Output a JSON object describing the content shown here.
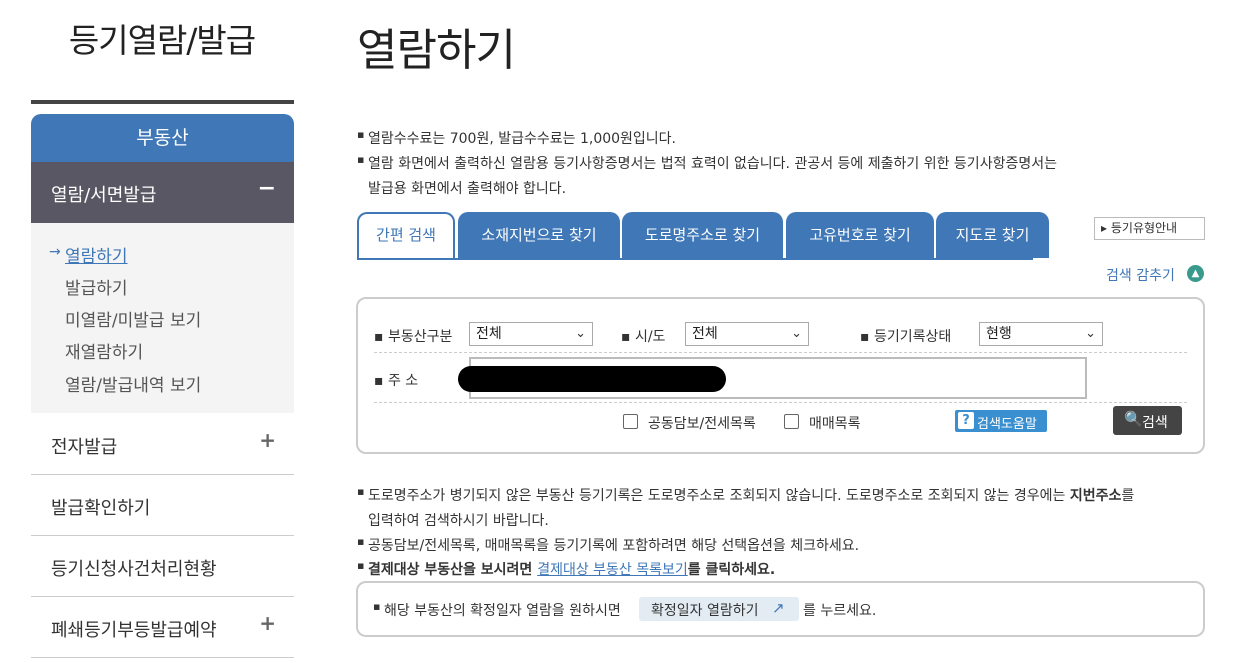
{
  "sidebar": {
    "title": "등기열람/발급",
    "category": "부동산",
    "active_section": {
      "label": "열람/서면발급",
      "toggle": "−"
    },
    "sub_items": [
      {
        "label": "열람하기"
      },
      {
        "label": "발급하기"
      },
      {
        "label": "미열람/미발급 보기"
      },
      {
        "label": "재열람하기"
      },
      {
        "label": "열람/발급내역 보기"
      }
    ],
    "sub_arrow": "→",
    "menus": [
      {
        "label": "전자발급",
        "toggle": "+"
      },
      {
        "label": "발급확인하기",
        "toggle": ""
      },
      {
        "label": "등기신청사건처리현황",
        "toggle": ""
      },
      {
        "label": "폐쇄등기부등발급예약",
        "toggle": "+"
      }
    ]
  },
  "main": {
    "title": "열람하기",
    "notices": [
      "열람수수료는 700원, 발급수수료는 1,000원입니다.",
      "열람 화면에서 출력하신 열람용 등기사항증명서는 법적 효력이 없습니다. 관공서 등에 제출하기 위한 등기사항증명서는",
      "발급용 화면에서 출력해야 합니다."
    ],
    "tabs": [
      {
        "label": "간편 검색"
      },
      {
        "label": "소재지번으로 찾기"
      },
      {
        "label": "도로명주소로 찾기"
      },
      {
        "label": "고유번호로 찾기"
      },
      {
        "label": "지도로 찾기"
      }
    ],
    "guide_button": "등기유형안내",
    "guide_arrow": "▸",
    "fold_label": "검색 감추기",
    "fold_icon": "▲",
    "search": {
      "type_label": "부동산구분",
      "type_value": "전체",
      "region_label": "시/도",
      "region_value": "전체",
      "status_label": "등기기록상태",
      "status_value": "현행",
      "address_label": "주 소",
      "address_value": "",
      "option1": "공동담보/전세목록",
      "option2": "매매목록",
      "help_label": "검색도움말",
      "help_icon": "?",
      "search_label": "검색",
      "search_icon": "🔍",
      "caret": "⌄",
      "bullet": "▪"
    },
    "info": {
      "line1a": "도로명주소가 병기되지 않은 부동산 등기기록은 도로명주소로 조회되지 않습니다. 도로명주소로 조회되지 않는 경우에는 ",
      "line1b": "지번주소",
      "line1c": "를",
      "line2": "입력하여 검색하시기 바랍니다.",
      "line3": "공동담보/전세목록, 매매목록을 등기기록에 포함하려면 해당 선택옵션을 체크하세요.",
      "line4a": "결제대상 부동산을 보시려면 ",
      "line4b": "결제대상 부동산 목록보기",
      "line4c": "를 클릭하세요."
    },
    "confirm": {
      "prefix": "해당 부동산의 확정일자 열람을 원하시면",
      "button": "확정일자 열람하기",
      "icon": "↗",
      "suffix": "를 누르세요."
    }
  }
}
